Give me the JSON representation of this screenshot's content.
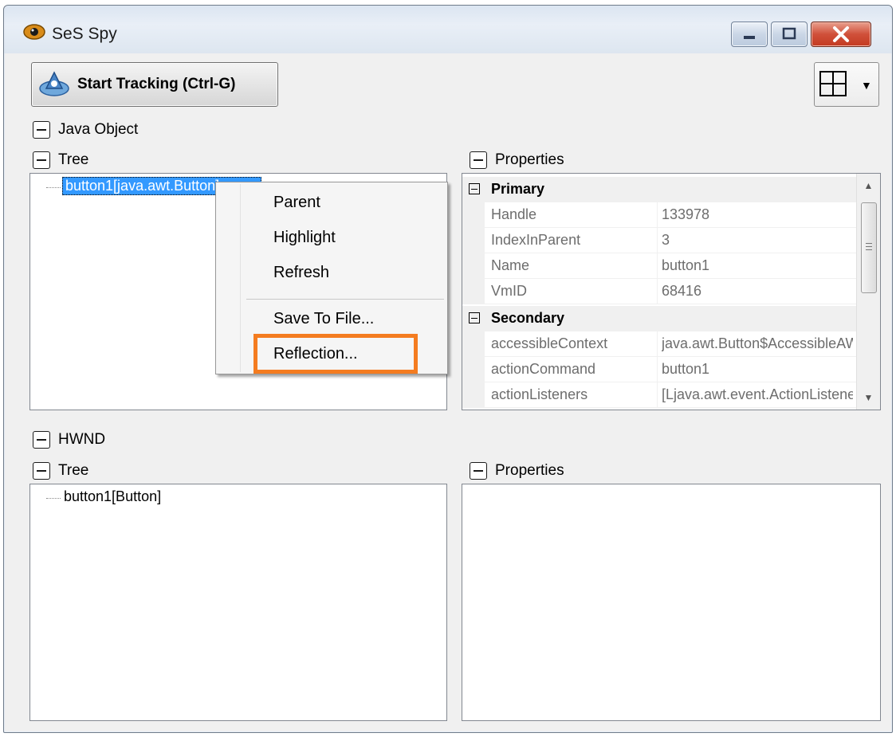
{
  "window": {
    "title": "SeS Spy"
  },
  "toolbar": {
    "start_tracking_label": "Start Tracking (Ctrl-G)"
  },
  "java_object": {
    "section_label": "Java Object",
    "tree_label": "Tree",
    "properties_label": "Properties",
    "tree_node": "button1[java.awt.Button]",
    "properties": {
      "primary": {
        "category": "Primary",
        "rows": [
          {
            "name": "Handle",
            "value": "133978"
          },
          {
            "name": "IndexInParent",
            "value": "3"
          },
          {
            "name": "Name",
            "value": "button1"
          },
          {
            "name": "VmID",
            "value": "68416"
          }
        ]
      },
      "secondary": {
        "category": "Secondary",
        "rows": [
          {
            "name": "accessibleContext",
            "value": "java.awt.Button$AccessibleAWTButton"
          },
          {
            "name": "actionCommand",
            "value": "button1"
          },
          {
            "name": "actionListeners",
            "value": "[Ljava.awt.event.ActionListener"
          }
        ]
      }
    }
  },
  "context_menu": {
    "items": [
      "Parent",
      "Highlight",
      "Refresh",
      "Save To File...",
      "Reflection..."
    ]
  },
  "hwnd": {
    "section_label": "HWND",
    "tree_label": "Tree",
    "properties_label": "Properties",
    "tree_node": "button1[Button]"
  },
  "colors": {
    "selection": "#3399ff",
    "highlight_box": "#f47c20",
    "close_button": "#c33b22"
  }
}
